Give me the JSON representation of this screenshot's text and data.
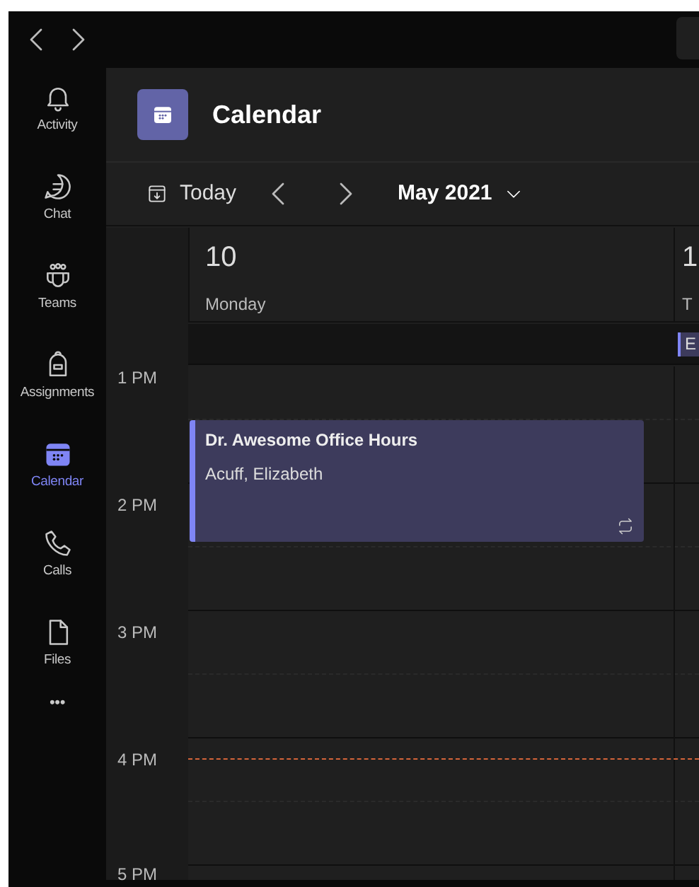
{
  "rail": {
    "items": [
      {
        "label": "Activity",
        "selected": false
      },
      {
        "label": "Chat",
        "selected": false
      },
      {
        "label": "Teams",
        "selected": false
      },
      {
        "label": "Assignments",
        "selected": false
      },
      {
        "label": "Calendar",
        "selected": true
      },
      {
        "label": "Calls",
        "selected": false
      },
      {
        "label": "Files",
        "selected": false
      }
    ],
    "more": "•••"
  },
  "header": {
    "title": "Calendar"
  },
  "toolbar": {
    "today": "Today",
    "month": "May 2021"
  },
  "days": [
    {
      "number": "10",
      "weekday": "Monday"
    },
    {
      "number": "1",
      "weekday": "T",
      "all_day": "E"
    }
  ],
  "time_labels": [
    "1 PM",
    "2 PM",
    "3 PM",
    "4 PM",
    "5 PM"
  ],
  "event": {
    "title": "Dr. Awesome Office Hours",
    "organizer": "Acuff, Elizabeth",
    "recurring": true
  }
}
